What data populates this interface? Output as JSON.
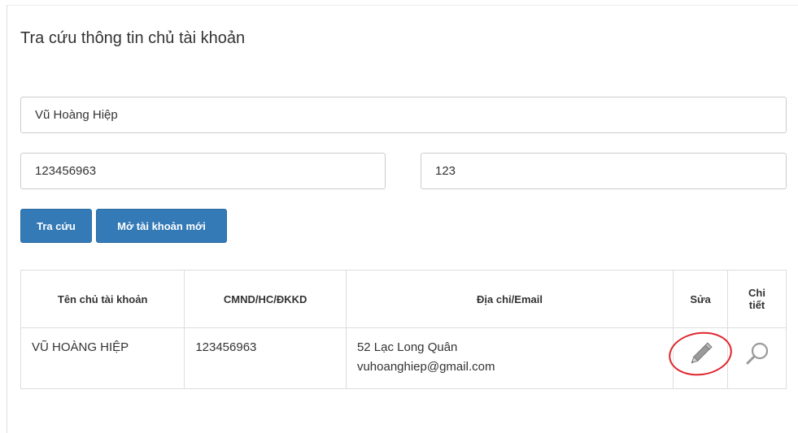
{
  "page": {
    "title": "Tra cứu thông tin chủ tài khoản"
  },
  "form": {
    "name_value": "Vũ Hoàng Hiệp",
    "id_value": "123456963",
    "code_value": "123"
  },
  "buttons": {
    "search_label": "Tra cứu",
    "new_account_label": "Mở tài khoản mới"
  },
  "table": {
    "headers": {
      "owner_name": "Tên chủ tài khoản",
      "id_number": "CMND/HC/ĐKKD",
      "address_email": "Địa chỉ/Email",
      "edit": "Sửa",
      "detail": "Chi tiết"
    },
    "rows": [
      {
        "owner_name": "VŨ HOÀNG HIỆP",
        "id_number": "123456963",
        "address": "52 Lạc Long Quân",
        "email": "vuhoanghiep@gmail.com",
        "edit_icon": "pencil-icon",
        "detail_icon": "magnifier-icon"
      }
    ]
  },
  "colors": {
    "primary_button": "#337ab7",
    "highlight_ring": "#e0262e",
    "border": "#dddddd"
  }
}
